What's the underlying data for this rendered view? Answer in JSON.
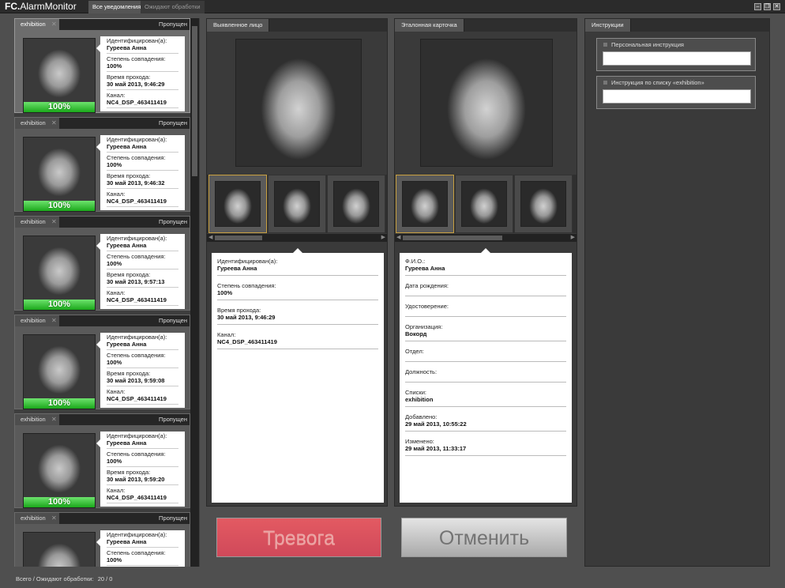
{
  "app": {
    "brand_bold": "FC.",
    "brand_rest": "AlarmMonitor",
    "tabs": [
      {
        "label": "Все уведомления",
        "active": true
      },
      {
        "label": "Ожидают обработки",
        "active": false
      }
    ]
  },
  "alert_labels": {
    "identified": "Идентифицирован(а):",
    "match": "Степень совпадения:",
    "time": "Время прохода:",
    "channel": "Канал:"
  },
  "alerts": [
    {
      "list": "exhibition",
      "status": "Пропущен",
      "name": "Гуреева Анна",
      "match": "100%",
      "time": "30 май 2013, 9:46:29",
      "channel": "NC4_DSP_463411419",
      "percent": "100%",
      "selected": true
    },
    {
      "list": "exhibition",
      "status": "Пропущен",
      "name": "Гуреева Анна",
      "match": "100%",
      "time": "30 май 2013, 9:46:32",
      "channel": "NC4_DSP_463411419",
      "percent": "100%",
      "selected": false
    },
    {
      "list": "exhibition",
      "status": "Пропущен",
      "name": "Гуреева Анна",
      "match": "100%",
      "time": "30 май 2013, 9:57:13",
      "channel": "NC4_DSP_463411419",
      "percent": "100%",
      "selected": false
    },
    {
      "list": "exhibition",
      "status": "Пропущен",
      "name": "Гуреева Анна",
      "match": "100%",
      "time": "30 май 2013, 9:59:08",
      "channel": "NC4_DSP_463411419",
      "percent": "100%",
      "selected": false
    },
    {
      "list": "exhibition",
      "status": "Пропущен",
      "name": "Гуреева Анна",
      "match": "100%",
      "time": "30 май 2013, 9:59:20",
      "channel": "NC4_DSP_463411419",
      "percent": "100%",
      "selected": false
    },
    {
      "list": "exhibition",
      "status": "Пропущен",
      "name": "Гуреева Анна",
      "match": "100%",
      "time": "",
      "channel": "",
      "percent": "",
      "selected": false
    }
  ],
  "detected": {
    "tab": "Выявленное лицо",
    "fields": [
      {
        "label": "Идентифицирован(а):",
        "value": "Гуреева Анна"
      },
      {
        "label": "Степень совпадения:",
        "value": "100%"
      },
      {
        "label": "Время прохода:",
        "value": "30 май 2013, 9:46:29"
      },
      {
        "label": "Канал:",
        "value": "NC4_DSP_463411419"
      }
    ]
  },
  "reference": {
    "tab": "Эталонная карточка",
    "fields": [
      {
        "label": "Ф.И.О.:",
        "value": "Гуреева Анна"
      },
      {
        "label": "Дата рождения:",
        "value": ""
      },
      {
        "label": "Удостоверение:",
        "value": ""
      },
      {
        "label": "Организация:",
        "value": "Вокорд"
      },
      {
        "label": "Отдел:",
        "value": ""
      },
      {
        "label": "Должность:",
        "value": ""
      },
      {
        "label": "Списки:",
        "value": "exhibition"
      },
      {
        "label": "Добавлено:",
        "value": "29 май 2013, 10:55:22"
      },
      {
        "label": "Изменено:",
        "value": "29 май 2013, 11:33:17"
      }
    ]
  },
  "buttons": {
    "alarm": "Тревога",
    "cancel": "Отменить"
  },
  "instructions": {
    "tab": "Инструкции",
    "personal": "Персональная инструкция",
    "list": "Инструкция по списку «exhibition»"
  },
  "status": {
    "text": "Всего / Ожидают обработки:",
    "counts": "20 / 0"
  },
  "colors": {
    "alarm": "#d8515d",
    "match_bar": "#2fbf2f",
    "selected_border": "#c8a040"
  }
}
